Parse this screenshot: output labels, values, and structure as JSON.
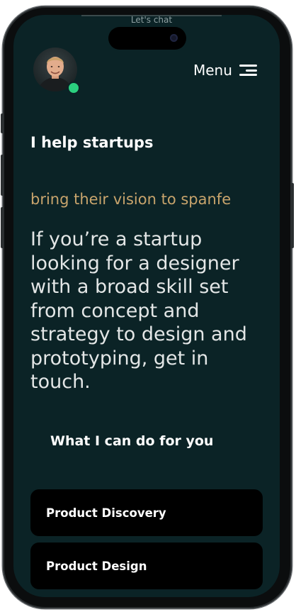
{
  "top_bar": {
    "chat_label": "Let's chat"
  },
  "header": {
    "menu_label": "Menu"
  },
  "hero": {
    "headline": "I help startups",
    "rotating_text": "bring their vision to spanfe",
    "intro": "If you’re a startup looking for a designer with a broad skill set from concept and strategy to design and prototyping, get in touch."
  },
  "services": {
    "title": "What I can do for you",
    "items": [
      {
        "label": "Product Discovery"
      },
      {
        "label": "Product Design"
      }
    ]
  },
  "colors": {
    "background": "#0b2326",
    "accent_gold": "#c8a46c",
    "status_online": "#2bd07f",
    "card": "#000000"
  },
  "icons": {
    "menu": "hamburger-icon",
    "avatar_status": "online-status-dot"
  }
}
